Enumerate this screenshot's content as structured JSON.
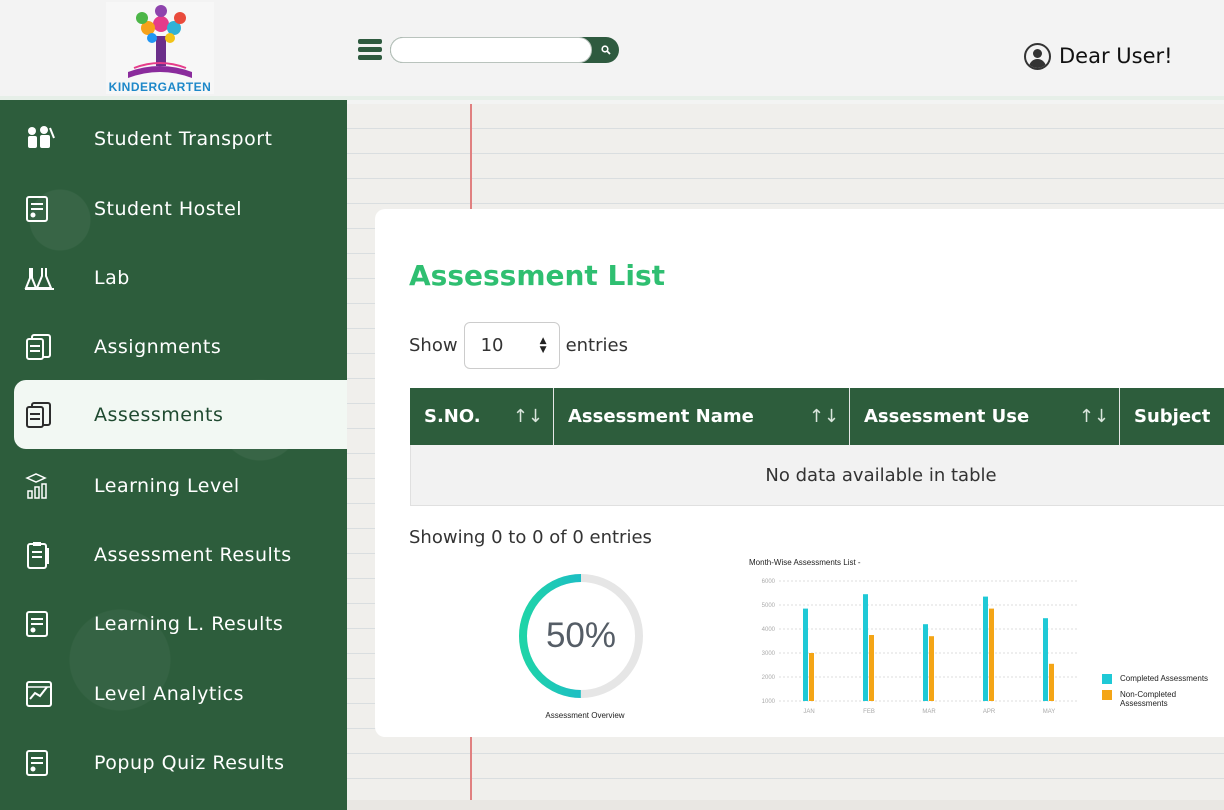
{
  "header": {
    "logo_text": "KINDERGARTEN",
    "search": {
      "value": "",
      "placeholder": ""
    },
    "user_name": "Dear User!",
    "icons": {
      "menu": "hamburger-icon",
      "search": "search-icon",
      "user": "user-circle-icon"
    }
  },
  "sidebar": {
    "items": [
      {
        "label": "Student Transport",
        "icon": "bus-children-icon",
        "active": false
      },
      {
        "label": "Student Hostel",
        "icon": "hostel-document-icon",
        "active": false
      },
      {
        "label": "Lab",
        "icon": "flask-icon",
        "active": false
      },
      {
        "label": "Assignments",
        "icon": "assignment-pages-icon",
        "active": false
      },
      {
        "label": "Assessments",
        "icon": "assessment-pages-icon",
        "active": true
      },
      {
        "label": "Learning Level",
        "icon": "graduation-chart-icon",
        "active": false
      },
      {
        "label": "Assessment Results",
        "icon": "clipboard-results-icon",
        "active": false
      },
      {
        "label": "Learning L. Results",
        "icon": "results-document-icon",
        "active": false
      },
      {
        "label": "Level Analytics",
        "icon": "analytics-chart-icon",
        "active": false
      },
      {
        "label": "Popup Quiz Results",
        "icon": "quiz-document-icon",
        "active": false
      }
    ]
  },
  "main": {
    "title": "Assessment List",
    "show_label": "Show",
    "entries_label": "entries",
    "entries_value": "10",
    "table": {
      "columns": [
        "S.NO.",
        "Assessment Name",
        "Assessment Use",
        "Subject"
      ],
      "empty_message": "No data available in table"
    },
    "info_text": "Showing 0 to 0 of 0 entries"
  },
  "colors": {
    "primary_green": "#2d5d3c",
    "title_green": "#2fbf71",
    "completed": "#1fc9d6",
    "non_completed": "#f4a516",
    "donut_track": "#e6e6e6"
  },
  "donut": {
    "value_text": "50%",
    "fraction": 0.5,
    "caption": "Assessment Overview"
  },
  "chart_data": {
    "type": "bar",
    "title": "Month-Wise Assessments List -",
    "categories": [
      "JAN",
      "FEB",
      "MAR",
      "APR",
      "MAY"
    ],
    "y_ticks": [
      "1000",
      "2000",
      "3000",
      "4000",
      "5000",
      "6000"
    ],
    "ylim": [
      1000,
      6000
    ],
    "series": [
      {
        "name": "Completed Assessments",
        "values": [
          4850,
          5450,
          4200,
          5350,
          4450
        ]
      },
      {
        "name": "Non-Completed Assessments",
        "values": [
          3000,
          3750,
          3700,
          4850,
          2550
        ]
      }
    ],
    "legend": "right",
    "grid": true
  }
}
